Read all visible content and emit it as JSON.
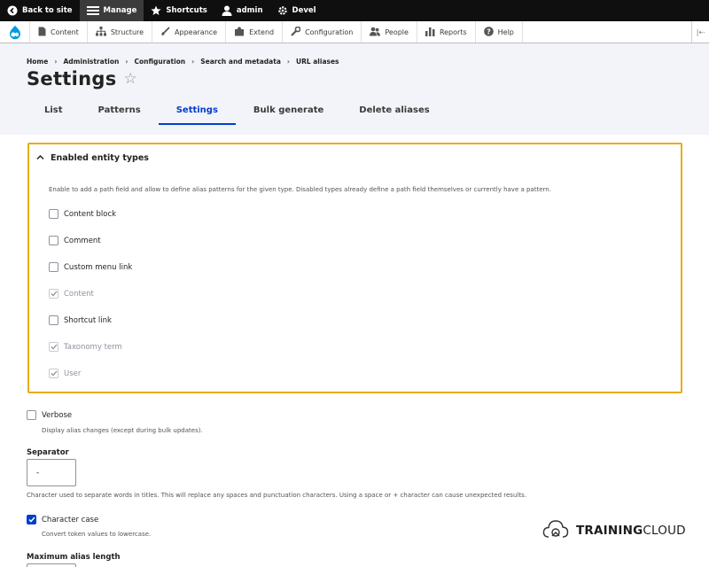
{
  "toolbar": {
    "back": "Back to site",
    "manage": "Manage",
    "shortcuts": "Shortcuts",
    "user": "admin",
    "devel": "Devel"
  },
  "tray": {
    "items": [
      "Content",
      "Structure",
      "Appearance",
      "Extend",
      "Configuration",
      "People",
      "Reports",
      "Help"
    ]
  },
  "breadcrumb": [
    "Home",
    "Administration",
    "Configuration",
    "Search and metadata",
    "URL aliases"
  ],
  "page": {
    "title": "Settings"
  },
  "tabs": [
    "List",
    "Patterns",
    "Settings",
    "Bulk generate",
    "Delete aliases"
  ],
  "active_tab": "Settings",
  "entity_types": {
    "summary": "Enabled entity types",
    "description": "Enable to add a path field and allow to define alias patterns for the given type. Disabled types already define a path field themselves or currently have a pattern.",
    "options": [
      {
        "label": "Content block",
        "checked": false,
        "disabled": false
      },
      {
        "label": "Comment",
        "checked": false,
        "disabled": false
      },
      {
        "label": "Custom menu link",
        "checked": false,
        "disabled": false
      },
      {
        "label": "Content",
        "checked": true,
        "disabled": true
      },
      {
        "label": "Shortcut link",
        "checked": false,
        "disabled": false
      },
      {
        "label": "Taxonomy term",
        "checked": true,
        "disabled": true
      },
      {
        "label": "User",
        "checked": true,
        "disabled": true
      }
    ]
  },
  "verbose": {
    "label": "Verbose",
    "description": "Display alias changes (except during bulk updates).",
    "checked": false
  },
  "separator": {
    "label": "Separator",
    "value": "-",
    "description": "Character used to separate words in titles. This will replace any spaces and punctuation characters. Using a space or + character can cause unexpected results."
  },
  "character_case": {
    "label": "Character case",
    "description": "Convert token values to lowercase.",
    "checked": true
  },
  "max_alias_length": {
    "label": "Maximum alias length"
  },
  "watermark": {
    "bold": "TRAINING",
    "rest": "CLOUD"
  },
  "colors": {
    "accent": "#003ecc",
    "highlight_border": "#e8ac1a",
    "toolbar": "#0f0f0f",
    "header_bg": "#f3f4f9"
  }
}
